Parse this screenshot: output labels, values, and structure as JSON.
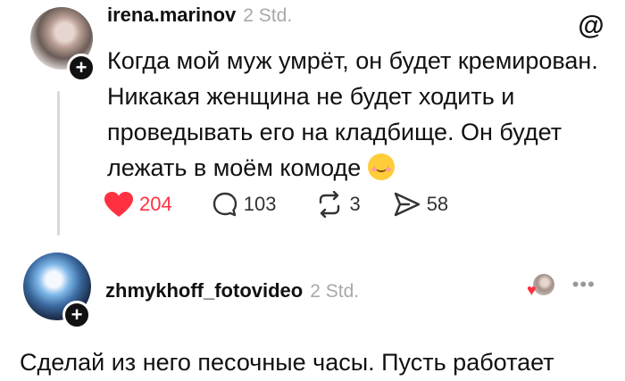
{
  "post": {
    "username": "irena.marinov",
    "time": "2 Std.",
    "text": "Когда мой муж умрёт, он будет кремирован. Никакая женщина не будет ходить и проведывать его на кладбище. Он будет лежать в моём комоде",
    "emoji": "relieved-face-emoji",
    "likes": "204",
    "comments": "103",
    "reposts": "3",
    "shares": "58"
  },
  "reply": {
    "username": "zhmykhoff_fotovideo",
    "time": "2 Std.",
    "text": "Сделай из него песочные часы. Пусть работает"
  },
  "colors": {
    "like": "#ff3040",
    "muted": "#a8a8a8",
    "text": "#111111"
  }
}
